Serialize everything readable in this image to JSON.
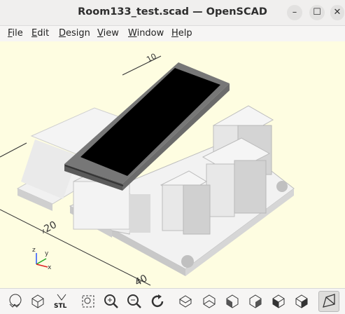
{
  "window": {
    "title": "Room133_test.scad — OpenSCAD"
  },
  "window_controls": {
    "minimize": "–",
    "maximize": "☐",
    "close": "✕"
  },
  "menu": [
    "File",
    "Edit",
    "Design",
    "View",
    "Window",
    "Help"
  ],
  "viewport": {
    "background": "#fefde1",
    "ruler_labels": [
      "20",
      "40",
      "10"
    ],
    "axes": {
      "x": "x",
      "y": "y",
      "z": "z"
    }
  },
  "toolbar": {
    "buttons": [
      "preview-icon",
      "render-icon",
      "export-stl-icon",
      "view-all-icon",
      "zoom-in-icon",
      "zoom-out-icon",
      "reset-view-icon",
      "top-view-icon",
      "bottom-view-icon",
      "left-view-icon",
      "right-view-icon",
      "front-view-icon",
      "back-view-icon",
      "perspective-icon"
    ],
    "stl_label": "STL"
  }
}
